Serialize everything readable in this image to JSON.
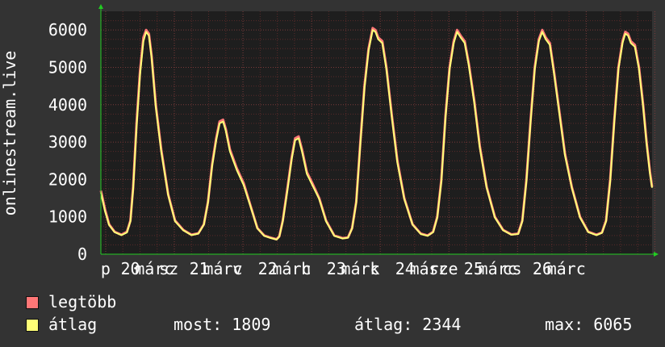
{
  "chart_data": {
    "type": "line",
    "ylabel": "onlinestream.live",
    "ylim": [
      0,
      6500
    ],
    "yticks": [
      0,
      1000,
      2000,
      3000,
      4000,
      5000,
      6000
    ],
    "xlim": [
      0,
      7.6
    ],
    "x_tick_labels": [
      {
        "x": 0.07,
        "label": "p"
      },
      {
        "x": 0.43,
        "label": "20"
      },
      {
        "x": 0.78,
        "label": "márc"
      },
      {
        "x": 0.99,
        "label": "sz"
      },
      {
        "x": 1.43,
        "label": "21"
      },
      {
        "x": 1.78,
        "label": "márc"
      },
      {
        "x": 1.99,
        "label": "v"
      },
      {
        "x": 2.43,
        "label": "22"
      },
      {
        "x": 2.78,
        "label": "márc"
      },
      {
        "x": 2.99,
        "label": "h"
      },
      {
        "x": 3.43,
        "label": "23"
      },
      {
        "x": 3.78,
        "label": "márc"
      },
      {
        "x": 3.99,
        "label": "k"
      },
      {
        "x": 4.43,
        "label": "24"
      },
      {
        "x": 4.78,
        "label": "márc"
      },
      {
        "x": 4.99,
        "label": "sze"
      },
      {
        "x": 5.43,
        "label": "25"
      },
      {
        "x": 5.78,
        "label": "márc"
      },
      {
        "x": 5.99,
        "label": "cs"
      },
      {
        "x": 6.43,
        "label": "26"
      },
      {
        "x": 6.78,
        "label": "márc"
      }
    ],
    "grid": true,
    "series": [
      {
        "name": "legtöbb",
        "color": "#ff7777",
        "points": [
          [
            0,
            1700
          ],
          [
            0.06,
            1200
          ],
          [
            0.12,
            800
          ],
          [
            0.2,
            600
          ],
          [
            0.3,
            520
          ],
          [
            0.38,
            600
          ],
          [
            0.43,
            900
          ],
          [
            0.47,
            1800
          ],
          [
            0.52,
            3500
          ],
          [
            0.57,
            4900
          ],
          [
            0.62,
            5800
          ],
          [
            0.66,
            6000
          ],
          [
            0.7,
            5900
          ],
          [
            0.74,
            5300
          ],
          [
            0.8,
            4000
          ],
          [
            0.88,
            2800
          ],
          [
            0.98,
            1600
          ],
          [
            1.08,
            900
          ],
          [
            1.2,
            650
          ],
          [
            1.32,
            520
          ],
          [
            1.42,
            560
          ],
          [
            1.5,
            800
          ],
          [
            1.56,
            1400
          ],
          [
            1.62,
            2400
          ],
          [
            1.68,
            3100
          ],
          [
            1.73,
            3550
          ],
          [
            1.78,
            3600
          ],
          [
            1.82,
            3350
          ],
          [
            1.88,
            2800
          ],
          [
            1.98,
            2300
          ],
          [
            2.08,
            1900
          ],
          [
            2.18,
            1300
          ],
          [
            2.28,
            700
          ],
          [
            2.38,
            500
          ],
          [
            2.46,
            450
          ],
          [
            2.56,
            400
          ],
          [
            2.6,
            480
          ],
          [
            2.65,
            900
          ],
          [
            2.72,
            1800
          ],
          [
            2.78,
            2600
          ],
          [
            2.83,
            3100
          ],
          [
            2.88,
            3150
          ],
          [
            2.93,
            2800
          ],
          [
            3.0,
            2200
          ],
          [
            3.08,
            1900
          ],
          [
            3.18,
            1500
          ],
          [
            3.28,
            900
          ],
          [
            3.4,
            500
          ],
          [
            3.52,
            430
          ],
          [
            3.6,
            450
          ],
          [
            3.66,
            700
          ],
          [
            3.72,
            1400
          ],
          [
            3.78,
            3000
          ],
          [
            3.84,
            4500
          ],
          [
            3.9,
            5500
          ],
          [
            3.96,
            6050
          ],
          [
            4.0,
            6000
          ],
          [
            4.04,
            5800
          ],
          [
            4.1,
            5700
          ],
          [
            4.16,
            5000
          ],
          [
            4.24,
            3700
          ],
          [
            4.32,
            2500
          ],
          [
            4.42,
            1500
          ],
          [
            4.54,
            800
          ],
          [
            4.66,
            550
          ],
          [
            4.76,
            500
          ],
          [
            4.84,
            600
          ],
          [
            4.9,
            1000
          ],
          [
            4.96,
            2000
          ],
          [
            5.02,
            3700
          ],
          [
            5.08,
            5000
          ],
          [
            5.14,
            5700
          ],
          [
            5.19,
            6000
          ],
          [
            5.24,
            5850
          ],
          [
            5.3,
            5700
          ],
          [
            5.36,
            5100
          ],
          [
            5.44,
            4100
          ],
          [
            5.52,
            2900
          ],
          [
            5.62,
            1800
          ],
          [
            5.74,
            1000
          ],
          [
            5.86,
            650
          ],
          [
            5.98,
            530
          ],
          [
            6.08,
            550
          ],
          [
            6.14,
            900
          ],
          [
            6.2,
            2000
          ],
          [
            6.26,
            3600
          ],
          [
            6.32,
            5000
          ],
          [
            6.38,
            5750
          ],
          [
            6.43,
            6000
          ],
          [
            6.48,
            5800
          ],
          [
            6.54,
            5650
          ],
          [
            6.6,
            4900
          ],
          [
            6.68,
            3800
          ],
          [
            6.76,
            2700
          ],
          [
            6.86,
            1800
          ],
          [
            6.98,
            1000
          ],
          [
            7.1,
            600
          ],
          [
            7.22,
            520
          ],
          [
            7.3,
            580
          ],
          [
            7.36,
            900
          ],
          [
            7.42,
            2000
          ],
          [
            7.48,
            3600
          ],
          [
            7.54,
            5000
          ],
          [
            7.6,
            5700
          ],
          [
            7.64,
            5950
          ],
          [
            7.68,
            5900
          ],
          [
            7.72,
            5700
          ],
          [
            7.78,
            5600
          ],
          [
            7.84,
            5000
          ],
          [
            7.9,
            4000
          ],
          [
            7.95,
            3000
          ],
          [
            8.0,
            2200
          ],
          [
            8.03,
            1800
          ]
        ]
      },
      {
        "name": "átlag",
        "color": "#ffff77",
        "points": [
          [
            0,
            1650
          ],
          [
            0.06,
            1150
          ],
          [
            0.12,
            780
          ],
          [
            0.2,
            590
          ],
          [
            0.3,
            510
          ],
          [
            0.38,
            580
          ],
          [
            0.43,
            880
          ],
          [
            0.47,
            1750
          ],
          [
            0.52,
            3400
          ],
          [
            0.57,
            4800
          ],
          [
            0.62,
            5700
          ],
          [
            0.66,
            5950
          ],
          [
            0.7,
            5850
          ],
          [
            0.74,
            5250
          ],
          [
            0.8,
            3950
          ],
          [
            0.88,
            2750
          ],
          [
            0.98,
            1580
          ],
          [
            1.08,
            880
          ],
          [
            1.2,
            640
          ],
          [
            1.32,
            510
          ],
          [
            1.42,
            550
          ],
          [
            1.5,
            790
          ],
          [
            1.56,
            1380
          ],
          [
            1.62,
            2350
          ],
          [
            1.68,
            3050
          ],
          [
            1.73,
            3500
          ],
          [
            1.78,
            3550
          ],
          [
            1.82,
            3300
          ],
          [
            1.88,
            2750
          ],
          [
            1.98,
            2250
          ],
          [
            2.08,
            1850
          ],
          [
            2.18,
            1280
          ],
          [
            2.28,
            690
          ],
          [
            2.38,
            490
          ],
          [
            2.46,
            440
          ],
          [
            2.56,
            390
          ],
          [
            2.6,
            470
          ],
          [
            2.65,
            880
          ],
          [
            2.72,
            1750
          ],
          [
            2.78,
            2550
          ],
          [
            2.83,
            3050
          ],
          [
            2.88,
            3100
          ],
          [
            2.93,
            2750
          ],
          [
            3.0,
            2150
          ],
          [
            3.08,
            1850
          ],
          [
            3.18,
            1480
          ],
          [
            3.28,
            880
          ],
          [
            3.4,
            490
          ],
          [
            3.52,
            420
          ],
          [
            3.6,
            440
          ],
          [
            3.66,
            690
          ],
          [
            3.72,
            1380
          ],
          [
            3.78,
            2950
          ],
          [
            3.84,
            4450
          ],
          [
            3.9,
            5450
          ],
          [
            3.96,
            6000
          ],
          [
            4.0,
            5950
          ],
          [
            4.04,
            5750
          ],
          [
            4.1,
            5650
          ],
          [
            4.16,
            4950
          ],
          [
            4.24,
            3650
          ],
          [
            4.32,
            2450
          ],
          [
            4.42,
            1480
          ],
          [
            4.54,
            790
          ],
          [
            4.66,
            540
          ],
          [
            4.76,
            490
          ],
          [
            4.84,
            590
          ],
          [
            4.9,
            980
          ],
          [
            4.96,
            1950
          ],
          [
            5.02,
            3650
          ],
          [
            5.08,
            4950
          ],
          [
            5.14,
            5650
          ],
          [
            5.19,
            5950
          ],
          [
            5.24,
            5800
          ],
          [
            5.3,
            5650
          ],
          [
            5.36,
            5050
          ],
          [
            5.44,
            4050
          ],
          [
            5.52,
            2850
          ],
          [
            5.62,
            1780
          ],
          [
            5.74,
            980
          ],
          [
            5.86,
            640
          ],
          [
            5.98,
            520
          ],
          [
            6.08,
            540
          ],
          [
            6.14,
            880
          ],
          [
            6.2,
            1950
          ],
          [
            6.26,
            3550
          ],
          [
            6.32,
            4950
          ],
          [
            6.38,
            5700
          ],
          [
            6.43,
            5950
          ],
          [
            6.48,
            5750
          ],
          [
            6.54,
            5600
          ],
          [
            6.6,
            4850
          ],
          [
            6.68,
            3750
          ],
          [
            6.76,
            2650
          ],
          [
            6.86,
            1780
          ],
          [
            6.98,
            980
          ],
          [
            7.1,
            590
          ],
          [
            7.22,
            510
          ],
          [
            7.3,
            570
          ],
          [
            7.36,
            880
          ],
          [
            7.42,
            1950
          ],
          [
            7.48,
            3550
          ],
          [
            7.54,
            4950
          ],
          [
            7.6,
            5650
          ],
          [
            7.64,
            5900
          ],
          [
            7.68,
            5850
          ],
          [
            7.72,
            5650
          ],
          [
            7.78,
            5550
          ],
          [
            7.84,
            4950
          ],
          [
            7.9,
            3950
          ],
          [
            7.95,
            2950
          ],
          [
            8.0,
            2150
          ],
          [
            8.03,
            1780
          ]
        ]
      }
    ]
  },
  "legend": {
    "items": [
      {
        "label": "legtöbb",
        "color": "#ff7777"
      },
      {
        "label": "átlag",
        "color": "#ffff77"
      }
    ]
  },
  "stats": {
    "now": "most: 1809",
    "avg": "átlag: 2344",
    "max": "max: 6065"
  },
  "colors": {
    "background": "#333333",
    "plot_background": "#1e1e1e",
    "grid_major": "#7a3a3a",
    "grid_minor": "#5a2a2a",
    "axis_arrow": "#22cc22",
    "text": "#ffffff"
  }
}
